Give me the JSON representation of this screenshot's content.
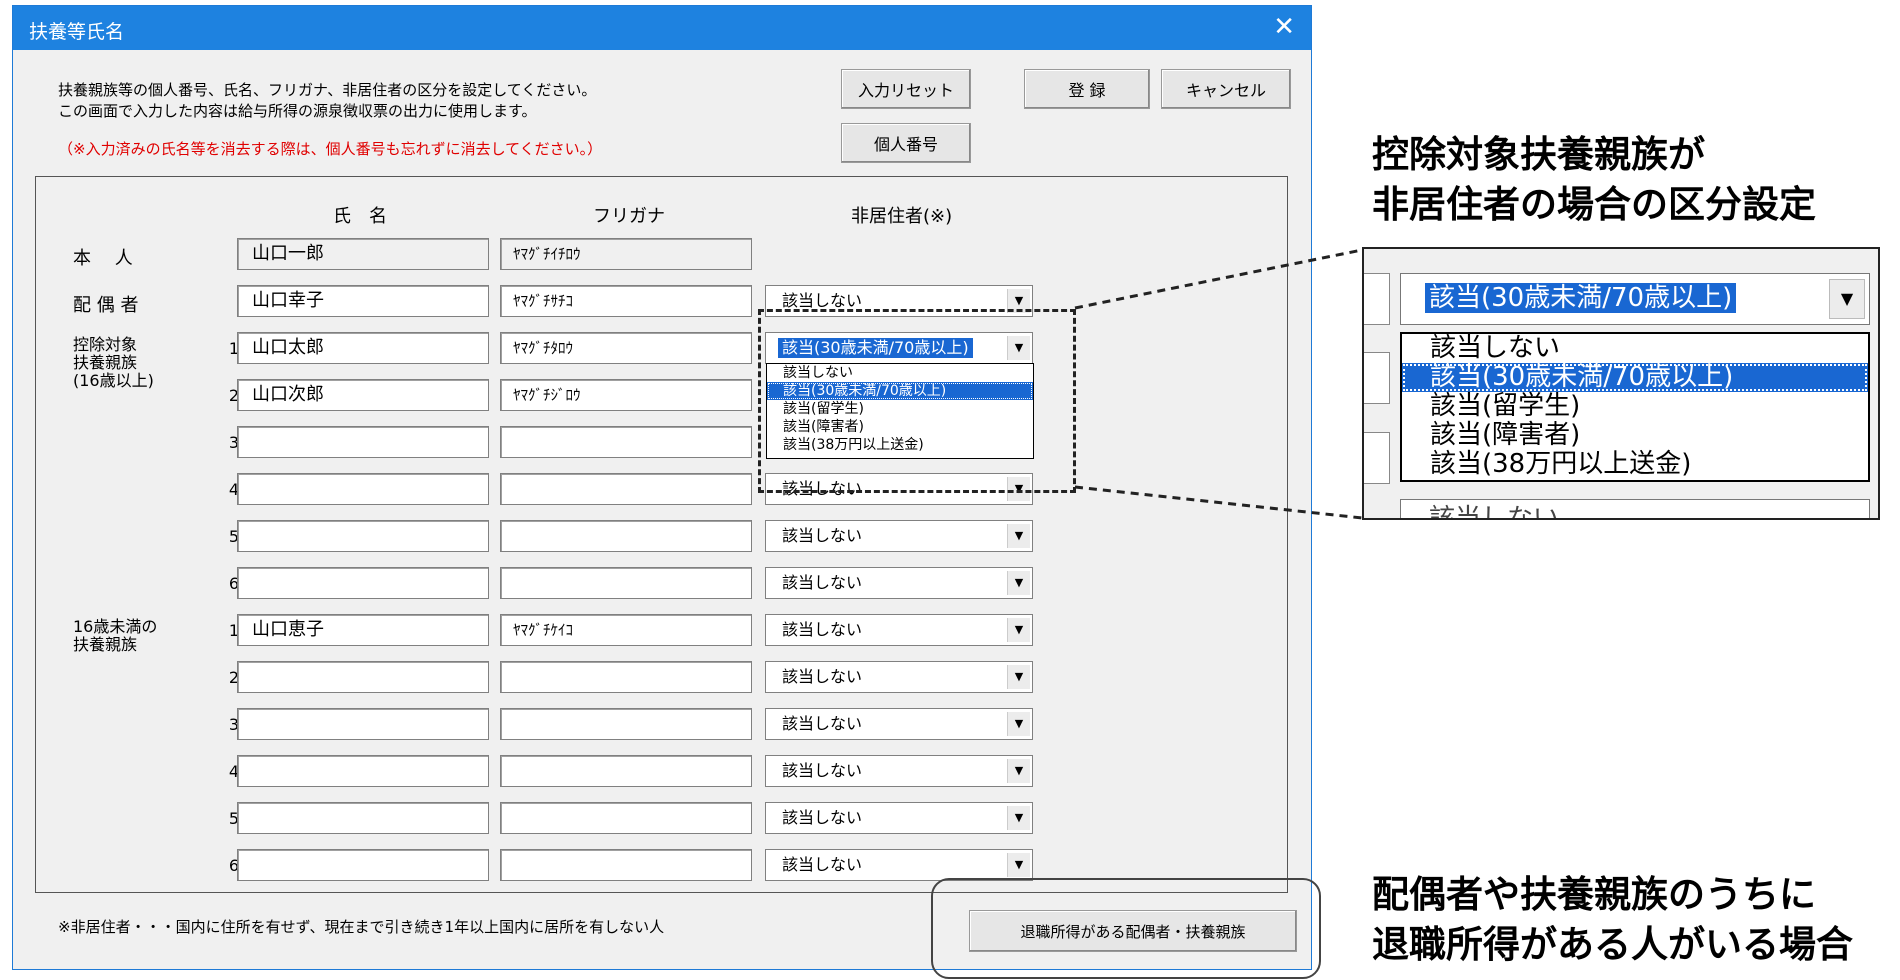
{
  "window": {
    "title": "扶養等氏名",
    "close_icon": "close-icon"
  },
  "instructions": {
    "line1": "扶養親族等の個人番号、氏名、フリガナ、非居住者の区分を設定してください。",
    "line2": "この画面で入力した内容は給与所得の源泉徴収票の出力に使用します。",
    "warning": "（※入力済みの氏名等を消去する際は、個人番号も忘れずに消去してください。）"
  },
  "buttons": {
    "reset": "入力リセット",
    "register": "登 録",
    "cancel": "キャンセル",
    "mynumber": "個人番号",
    "retirement": "退職所得がある配偶者・扶養親族"
  },
  "headers": {
    "name": "氏　名",
    "furigana": "フリガナ",
    "nonresident": "非居住者(※)"
  },
  "labels": {
    "self": "本　 人",
    "spouse": "配 偶 者",
    "dep_group_line1": "控除対象",
    "dep_group_line2": "扶養親族",
    "dep_group_line3": "(16歳以上)",
    "young_group_line1": "16歳未満の",
    "young_group_line2": "扶養親族"
  },
  "self": {
    "name": "山口一郎",
    "furigana": "ﾔﾏｸﾞﾁｲﾁﾛｳ"
  },
  "spouse": {
    "name": "山口幸子",
    "furigana": "ﾔﾏｸﾞﾁｻﾁｺ",
    "nonresident": "該当しない"
  },
  "dependents": [
    {
      "num": "1",
      "name": "山口太郎",
      "furigana": "ﾔﾏｸﾞﾁﾀﾛｳ",
      "nonresident": "該当(30歳未満/70歳以上)"
    },
    {
      "num": "2",
      "name": "山口次郎",
      "furigana": "ﾔﾏｸﾞﾁｼﾞﾛｳ",
      "nonresident": ""
    },
    {
      "num": "3",
      "name": "",
      "furigana": "",
      "nonresident": ""
    },
    {
      "num": "4",
      "name": "",
      "furigana": "",
      "nonresident": "該当しない"
    },
    {
      "num": "5",
      "name": "",
      "furigana": "",
      "nonresident": "該当しない"
    },
    {
      "num": "6",
      "name": "",
      "furigana": "",
      "nonresident": "該当しない"
    }
  ],
  "young_dependents": [
    {
      "num": "1",
      "name": "山口恵子",
      "furigana": "ﾔﾏｸﾞﾁｹｲｺ",
      "nonresident": "該当しない"
    },
    {
      "num": "2",
      "name": "",
      "furigana": "",
      "nonresident": "該当しない"
    },
    {
      "num": "3",
      "name": "",
      "furigana": "",
      "nonresident": "該当しない"
    },
    {
      "num": "4",
      "name": "",
      "furigana": "",
      "nonresident": "該当しない"
    },
    {
      "num": "5",
      "name": "",
      "furigana": "",
      "nonresident": "該当しない"
    },
    {
      "num": "6",
      "name": "",
      "furigana": "",
      "nonresident": "該当しない"
    }
  ],
  "dropdown": {
    "options": [
      "該当しない",
      "該当(30歳未満/70歳以上)",
      "該当(留学生)",
      "該当(障害者)",
      "該当(38万円以上送金)"
    ],
    "selected_index": 1
  },
  "footnote": "※非居住者・・・国内に住所を有せず、現在まで引き続き1年以上国内に居所を有しない人",
  "callouts": {
    "top_line1": "控除対象扶養親族が",
    "top_line2": "非居住者の場合の区分設定",
    "bottom_line1": "配偶者や扶養親族のうちに",
    "bottom_line2": "退職所得がある人がいる場合"
  },
  "zoom": {
    "combo_value": "該当(30歳未満/70歳以上)",
    "options": [
      "該当しない",
      "該当(30歳未満/70歳以上)",
      "該当(留学生)",
      "該当(障害者)",
      "該当(38万円以上送金)"
    ],
    "bottom_partial": "該当しない"
  },
  "colors": {
    "titlebar": "#1e82e0",
    "selection": "#1967d2",
    "warning": "#e00000"
  }
}
